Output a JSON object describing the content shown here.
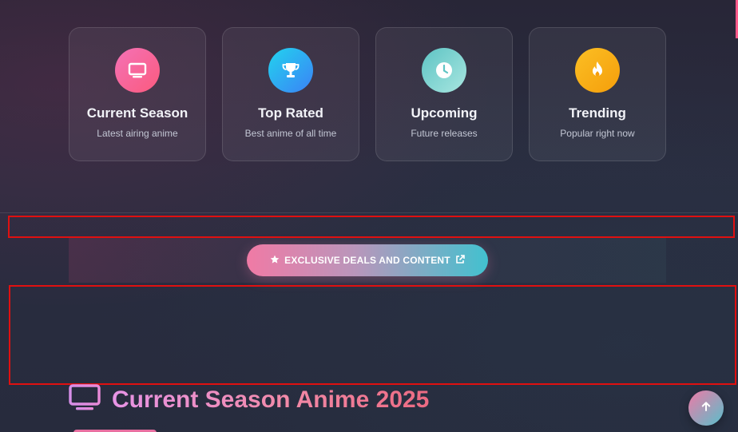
{
  "cards": [
    {
      "title": "Current Season",
      "subtitle": "Latest airing anime",
      "icon": "tv-icon",
      "gradient": [
        "#f472b6",
        "#fb5a7e"
      ]
    },
    {
      "title": "Top Rated",
      "subtitle": "Best anime of all time",
      "icon": "trophy-icon",
      "gradient": [
        "#22d3ee",
        "#3b82f6"
      ]
    },
    {
      "title": "Upcoming",
      "subtitle": "Future releases",
      "icon": "clock-icon",
      "gradient": [
        "#5ec4c4",
        "#a8e6e0"
      ]
    },
    {
      "title": "Trending",
      "subtitle": "Popular right now",
      "icon": "fire-icon",
      "gradient": [
        "#fbbf24",
        "#f59e0b"
      ]
    }
  ],
  "banner": {
    "button_label": "EXCLUSIVE DEALS AND CONTENT",
    "leading_icon": "star-icon",
    "trailing_icon": "external-link-icon"
  },
  "section": {
    "title": "Current Season Anime 2025",
    "icon": "tv-icon"
  },
  "scroll_top": {
    "icon": "arrow-up-icon"
  },
  "colors": {
    "accent_pink": "#f07aa5",
    "accent_teal": "#42c1cf",
    "background": "#282a3c",
    "highlight_box": "#e01010"
  }
}
